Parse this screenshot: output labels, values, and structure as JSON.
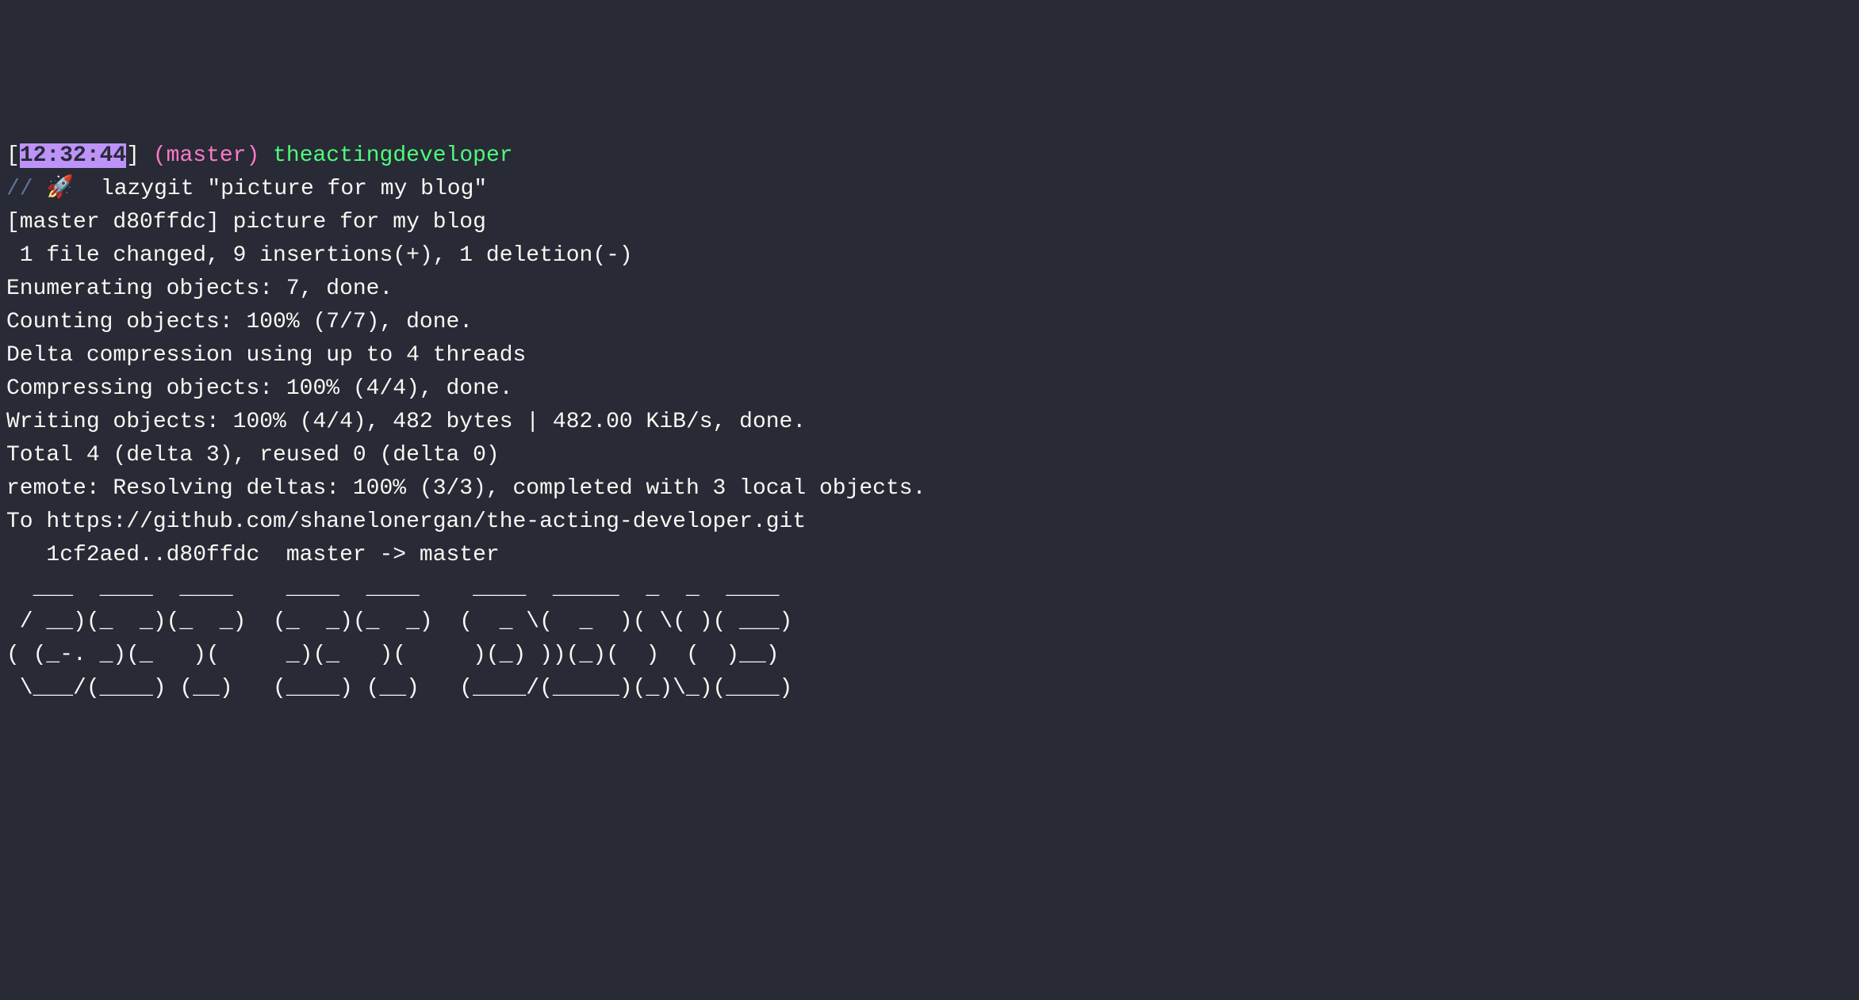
{
  "prompt": {
    "bracket_open": "[",
    "timestamp": "12:32:44",
    "bracket_close": "]",
    "branch_open": " (",
    "branch": "master",
    "branch_close": ")",
    "dirname": " theactingdeveloper"
  },
  "command": {
    "prefix": "// ",
    "emoji": "🚀",
    "text": "  lazygit \"picture for my blog\""
  },
  "output": {
    "line1": "[master d80ffdc] picture for my blog",
    "line2": " 1 file changed, 9 insertions(+), 1 deletion(-)",
    "line3": "Enumerating objects: 7, done.",
    "line4": "Counting objects: 100% (7/7), done.",
    "line5": "Delta compression using up to 4 threads",
    "line6": "Compressing objects: 100% (4/4), done.",
    "line7": "Writing objects: 100% (4/4), 482 bytes | 482.00 KiB/s, done.",
    "line8": "Total 4 (delta 3), reused 0 (delta 0)",
    "line9": "remote: Resolving deltas: 100% (3/3), completed with 3 local objects.",
    "line10": "To https://github.com/shanelonergan/the-acting-developer.git",
    "line11": "   1cf2aed..d80ffdc  master -> master",
    "line12": ""
  },
  "ascii": {
    "line1": "  ___  ____  ____    ____  ____    ____  _____  _  _  ____ ",
    "line2": " / __)(_  _)(_  _)  (_  _)(_  _)  (  _ \\(  _  )( \\( )( ___)",
    "line3": "( (_-. _)(_   )(     _)(_   )(     )(_) ))(_)(  )  (  )__) ",
    "line4": " \\___/(____) (__)   (____) (__)   (____/(_____)(_)\\_)(____)"
  }
}
